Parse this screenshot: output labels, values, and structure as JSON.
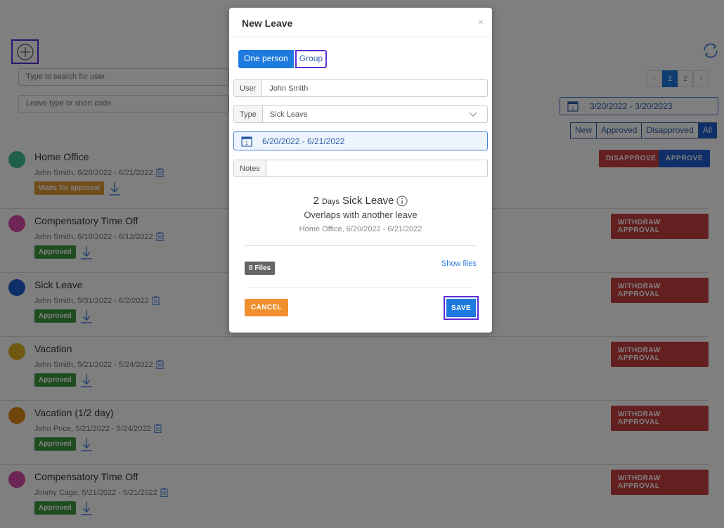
{
  "toolbar": {
    "search_user_placeholder": "Type to search for user",
    "search_leave_placeholder": "Leave type or short code"
  },
  "pager": {
    "prev": "‹",
    "pages": [
      "1",
      "2"
    ],
    "next": "›"
  },
  "range": "3/20/2022 - 3/20/2023",
  "filters": [
    "New",
    "Approved",
    "Disapproved",
    "All"
  ],
  "rows": [
    {
      "title": "Home Office",
      "sub": "John Smith,  6/20/2022 - 6/21/2022",
      "badge": "Waits for approval",
      "color": "#3fbf98"
    },
    {
      "title": "Compensatory Time Off",
      "sub": "John Smith,  6/10/2022 - 6/12/2022",
      "badge": "Approved",
      "color": "#d94ba8"
    },
    {
      "title": "Sick Leave",
      "sub": "John Smith,  5/31/2022 - 6/2/2022",
      "badge": "Approved",
      "color": "#1f5fd0"
    },
    {
      "title": "Vacation",
      "sub": "John Smith,  5/21/2022 - 5/24/2022",
      "badge": "Approved",
      "color": "#e0b020"
    },
    {
      "title": "Vacation (1/2 day)",
      "sub": "John Price,  5/21/2022 - 5/24/2022",
      "badge": "Approved",
      "color": "#e08a1a"
    },
    {
      "title": "Compensatory Time Off",
      "sub": "Jimmy Cage,  5/21/2022 - 5/21/2022",
      "badge": "Approved",
      "color": "#d94ba8"
    }
  ],
  "actions": {
    "disapprove": "DISAPPROVE",
    "approve": "APPROVE",
    "withdraw": "WITHDRAW APPROVAL"
  },
  "modal": {
    "title": "New Leave",
    "close": "×",
    "toggle": {
      "one": "One person",
      "group": "Group"
    },
    "user": {
      "label": "User",
      "value": "John Smith"
    },
    "type": {
      "label": "Type",
      "value": "Sick Leave"
    },
    "date": "6/20/2022 - 6/21/2022",
    "notes": {
      "label": "Notes",
      "value": ""
    },
    "summary": {
      "count": "2",
      "unit": "Days",
      "type": "Sick Leave",
      "overlap": "Overlaps with another leave",
      "detail": "Home Office,  6/20/2022 - 6/21/2022"
    },
    "files": "0 Files",
    "show_files": "Show files",
    "cancel": "CANCEL",
    "save": "SAVE"
  }
}
